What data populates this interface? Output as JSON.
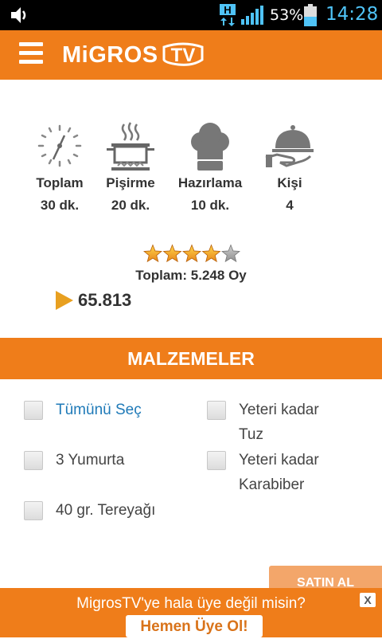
{
  "status_bar": {
    "battery_percent": "53%",
    "time": "14:28",
    "network_label": "H",
    "icons": [
      "volume-icon",
      "h-network-icon",
      "signal-icon",
      "battery-icon"
    ]
  },
  "app_bar": {
    "logo_text": "MiGROS",
    "logo_tv": "TV",
    "icons": [
      "hamburger-menu-icon"
    ]
  },
  "recipe_info": [
    {
      "label": "Toplam",
      "value": "30 dk.",
      "icon": "clock-icon"
    },
    {
      "label": "Pişirme",
      "value": "20 dk.",
      "icon": "cooking-pot-icon"
    },
    {
      "label": "Hazırlama",
      "value": "10 dk.",
      "icon": "chef-hat-icon"
    },
    {
      "label": "Kişi",
      "value": "4",
      "icon": "serving-cloche-icon"
    }
  ],
  "rating": {
    "stars": 4,
    "max_stars": 5,
    "votes_text": "Toplam: 5.248 Oy"
  },
  "views": {
    "count": "65.813",
    "icon": "play-triangle-icon"
  },
  "ingredients_section": {
    "title": "MALZEMELER",
    "select_all": "Tümünü Seç",
    "items_left": [
      "3 Yumurta",
      "40 gr. Tereyağı"
    ],
    "items_right": [
      {
        "line1": "Yeteri kadar",
        "line2": "Tuz"
      },
      {
        "line1": "Yeteri kadar",
        "line2": "Karabiber"
      }
    ]
  },
  "buy_button": {
    "label": "SATIN AL"
  },
  "banner": {
    "message": "MigrosTV'ye hala üye değil misin?",
    "cta": "Hemen Üye Ol!",
    "close": "X"
  },
  "colors": {
    "brand_orange": "#ef7d1a",
    "link_blue": "#1f7ab8",
    "clock_blue": "#4fc3f7"
  }
}
